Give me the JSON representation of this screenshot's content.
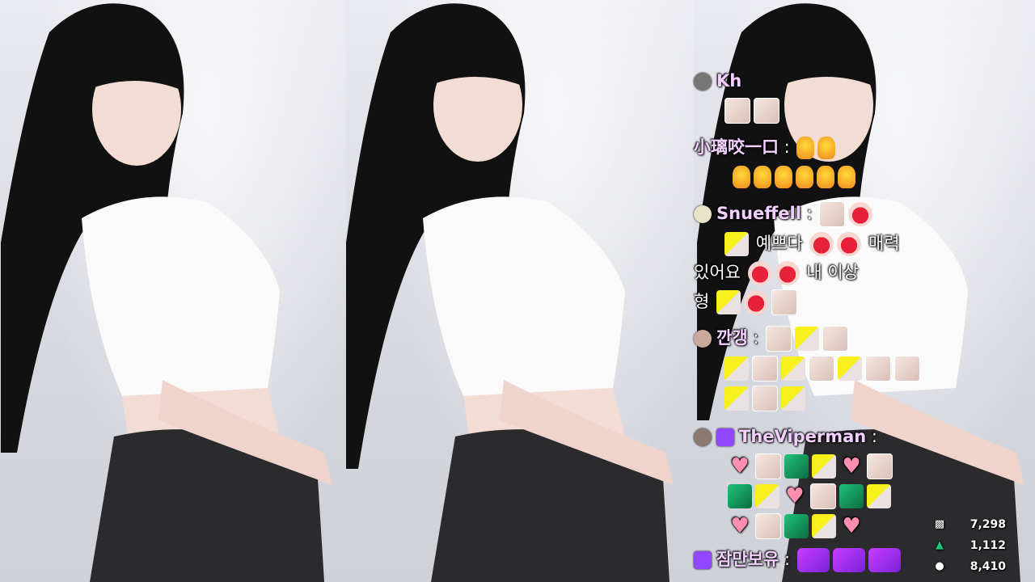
{
  "chat": {
    "messages": [
      {
        "user": "Kh",
        "sep": "",
        "text": ""
      },
      {
        "user": "小璃咬一口",
        "sep": " : ",
        "text": ""
      },
      {
        "user": "Snueffell",
        "sep": " : ",
        "text_parts": [
          "예쁘다",
          "매력",
          "있어요",
          "내 이상",
          "형"
        ]
      },
      {
        "user": "깐갱",
        "sep": " : ",
        "text": ""
      },
      {
        "user": "TheViperman",
        "sep": " : ",
        "text": ""
      },
      {
        "user": "잠만보유",
        "sep": " : ",
        "text": ""
      }
    ]
  },
  "stats": {
    "chat_count": "7,298",
    "bits": "1,112",
    "viewers": "8,410"
  },
  "colors": {
    "username": "#f3d0ff",
    "badge_purple": "#9146ff",
    "accent_green": "#1fc47a"
  },
  "icons": [
    "chat-bubble-icon",
    "bits-icon",
    "viewer-person-icon",
    "subscriber-badge-icon"
  ]
}
